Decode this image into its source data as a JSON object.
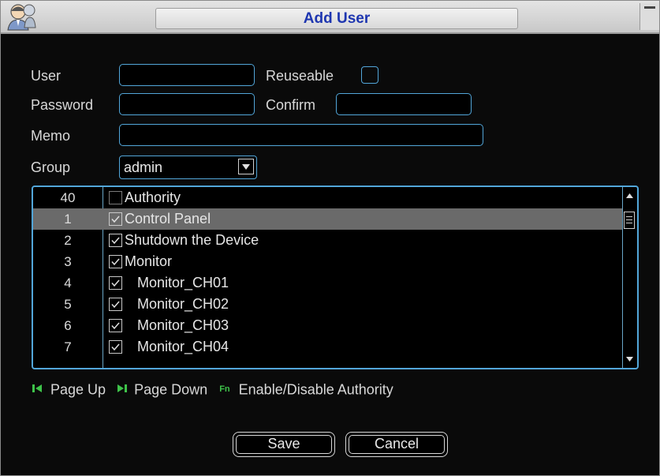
{
  "window": {
    "title": "Add User",
    "accent": "#1e36b0",
    "field_border": "#52a6d9"
  },
  "form": {
    "user_label": "User",
    "user_value": "",
    "reuseable_label": "Reuseable",
    "reuseable_checked": false,
    "password_label": "Password",
    "password_value": "",
    "confirm_label": "Confirm",
    "confirm_value": "",
    "memo_label": "Memo",
    "memo_value": "",
    "group_label": "Group",
    "group_value": "admin"
  },
  "table": {
    "header": {
      "num": "40",
      "authority": "Authority",
      "checked": false
    },
    "rows": [
      {
        "num": "1",
        "label": "Control Panel",
        "checked": true,
        "indent": false,
        "selected": true
      },
      {
        "num": "2",
        "label": "Shutdown the Device",
        "checked": true,
        "indent": false,
        "selected": false
      },
      {
        "num": "3",
        "label": "Monitor",
        "checked": true,
        "indent": false,
        "selected": false
      },
      {
        "num": "4",
        "label": "Monitor_CH01",
        "checked": true,
        "indent": true,
        "selected": false
      },
      {
        "num": "5",
        "label": "Monitor_CH02",
        "checked": true,
        "indent": true,
        "selected": false
      },
      {
        "num": "6",
        "label": "Monitor_CH03",
        "checked": true,
        "indent": true,
        "selected": false
      },
      {
        "num": "7",
        "label": "Monitor_CH04",
        "checked": true,
        "indent": true,
        "selected": false
      }
    ]
  },
  "hints": {
    "page_up": "Page Up",
    "page_down": "Page Down",
    "fn_key": "Fn",
    "toggle_authority": "Enable/Disable Authority"
  },
  "buttons": {
    "save": "Save",
    "cancel": "Cancel"
  }
}
